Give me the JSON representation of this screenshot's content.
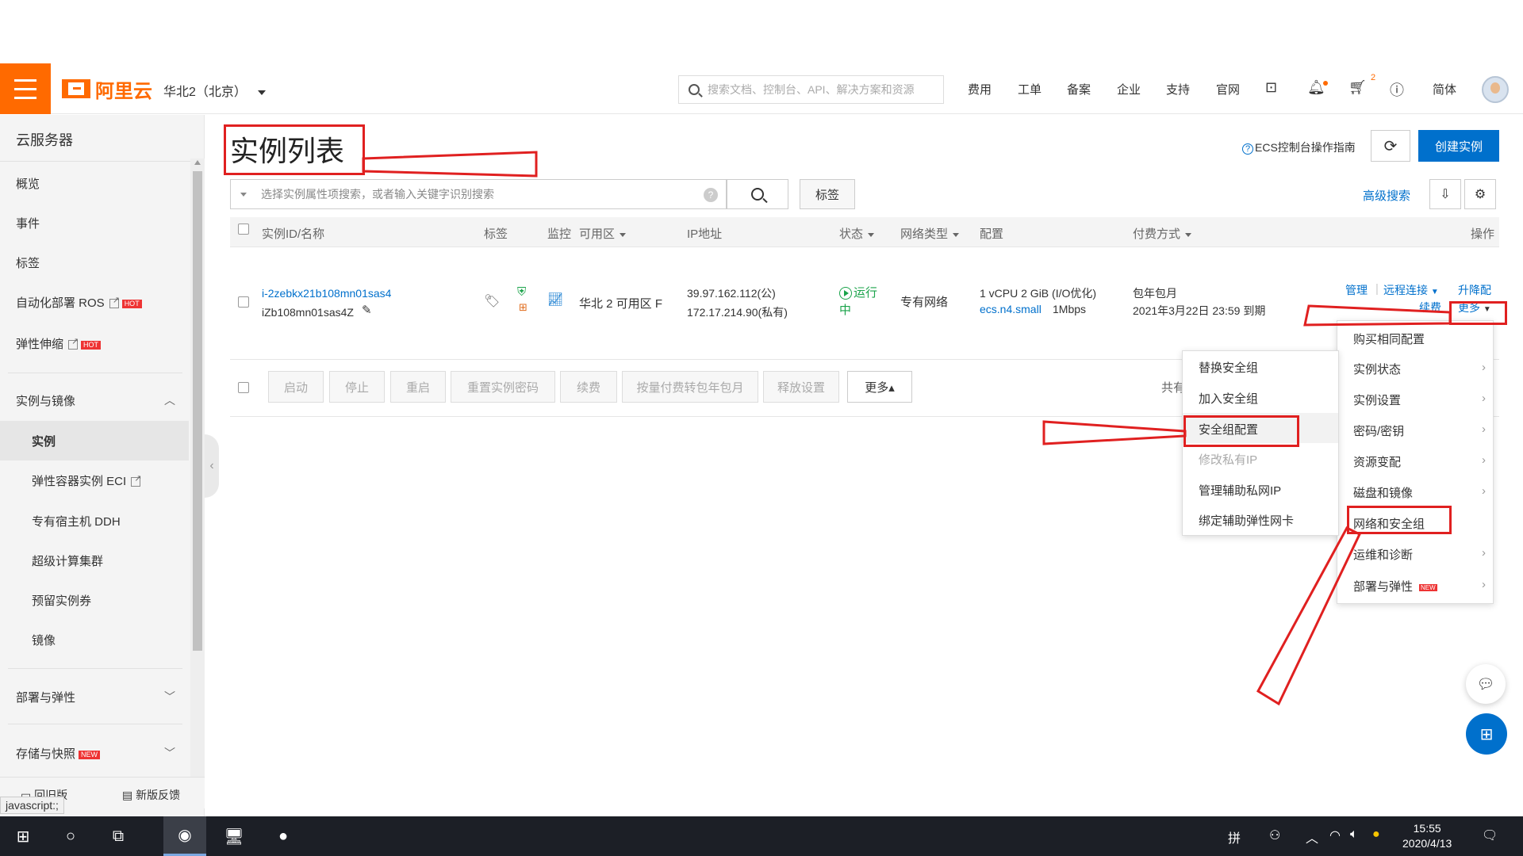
{
  "header": {
    "logo_text": "阿里云",
    "region": "华北2（北京）",
    "search_placeholder": "搜索文档、控制台、API、解决方案和资源",
    "nav": [
      "费用",
      "工单",
      "备案",
      "企业",
      "支持",
      "官网"
    ],
    "cart_count": "2",
    "lang": "简体"
  },
  "sidebar": {
    "title": "云服务器",
    "items": [
      {
        "label": "概览"
      },
      {
        "label": "事件"
      },
      {
        "label": "标签"
      },
      {
        "label": "自动化部署 ROS",
        "badge": "HOT"
      },
      {
        "label": "弹性伸缩",
        "badge": "HOT"
      }
    ],
    "group_instances": "实例与镜像",
    "sub_items": [
      {
        "label": "实例"
      },
      {
        "label": "弹性容器实例 ECI"
      },
      {
        "label": "专有宿主机 DDH"
      },
      {
        "label": "超级计算集群"
      },
      {
        "label": "预留实例券"
      },
      {
        "label": "镜像"
      }
    ],
    "group_deploy": "部署与弹性",
    "group_storage": "存储与快照",
    "storage_badge": "NEW",
    "footer_old": "回旧版",
    "footer_feedback": "新版反馈",
    "status_tip": "javascript:;"
  },
  "main": {
    "title": "实例列表",
    "guide": "ECS控制台操作指南",
    "create_button": "创建实例",
    "filter_placeholder": "选择实例属性项搜索，或者输入关键字识别搜索",
    "tag_button": "标签",
    "advanced_search": "高级搜索"
  },
  "table": {
    "columns": [
      "实例ID/名称",
      "标签",
      "监控",
      "可用区",
      "IP地址",
      "状态",
      "网络类型",
      "配置",
      "付费方式",
      "操作"
    ],
    "row": {
      "id": "i-2zebkx21b108mn01sas4",
      "name": "iZb108mn01sas4Z",
      "zone": "华北 2 可用区 F",
      "ip_public": "39.97.162.112(公)",
      "ip_private": "172.17.214.90(私有)",
      "status_line1": "运行",
      "status_line2": "中",
      "network": "专有网络",
      "config_line1": "1 vCPU 2 GiB (I/O优化)",
      "config_type": "ecs.n4.small",
      "config_bw": "1Mbps",
      "billing_line1": "包年包月",
      "billing_line2": "2021年3月22日 23:59 到期",
      "actions": {
        "manage": "管理",
        "remote": "远程连接",
        "upgrade": "升降配",
        "renew": "续费",
        "more": "更多"
      }
    },
    "bulk_buttons": [
      "启动",
      "停止",
      "重启",
      "重置实例密码",
      "续费",
      "按量付费转包年包月",
      "释放设置",
      "更多▴"
    ],
    "total_prefix": "共有"
  },
  "more_menu": {
    "items": [
      "购买相同配置",
      "实例状态",
      "实例设置",
      "密码/密钥",
      "资源变配",
      "磁盘和镜像",
      "网络和安全组",
      "运维和诊断",
      "部署与弹性"
    ],
    "deploy_badge": "NEW"
  },
  "network_submenu": {
    "items": [
      "替换安全组",
      "加入安全组",
      "安全组配置",
      "修改私有IP",
      "管理辅助私网IP",
      "绑定辅助弹性网卡"
    ]
  },
  "taskbar": {
    "time": "15:55",
    "date": "2020/4/13"
  },
  "colors": {
    "brand": "#ff6a00",
    "primary": "#0070cc",
    "annotation": "#e02020",
    "running": "#1aa34a"
  }
}
